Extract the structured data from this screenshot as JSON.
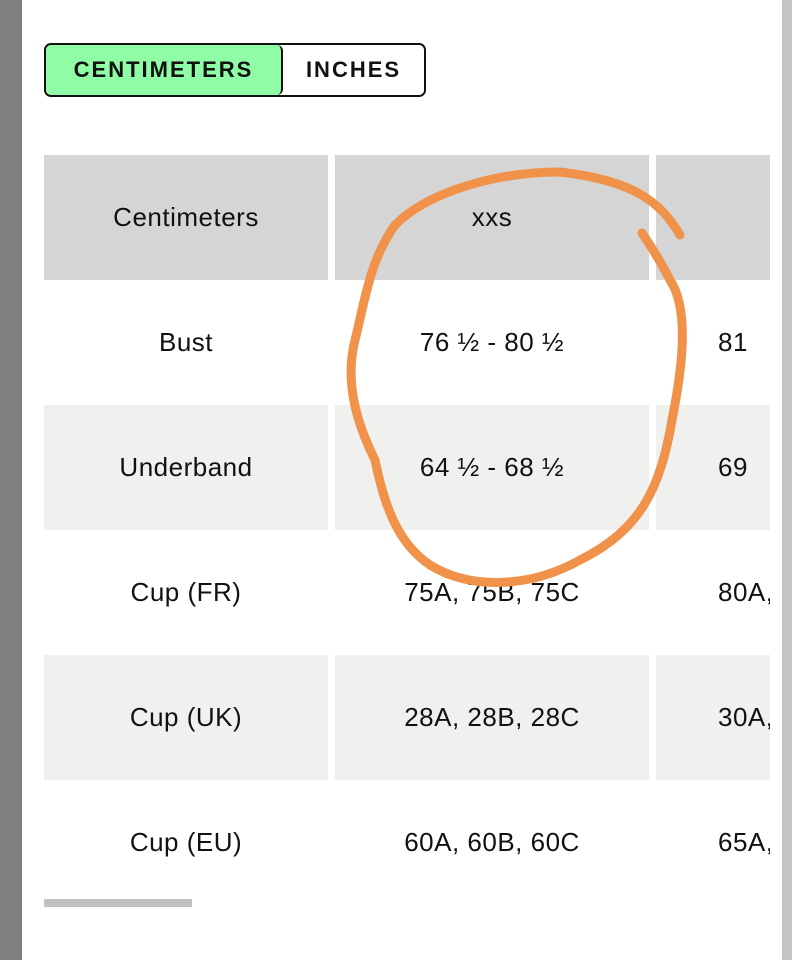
{
  "unit_toggle": {
    "options": [
      "CENTIMETERS",
      "INCHES"
    ],
    "selected": "CENTIMETERS",
    "active_color": "#8ffca6"
  },
  "table": {
    "header": [
      "Centimeters",
      "XXS",
      ""
    ],
    "rows": [
      [
        "Bust",
        "76 ½ - 80 ½",
        "81"
      ],
      [
        "Underband",
        "64 ½ - 68 ½",
        "69"
      ],
      [
        "Cup (FR)",
        "75A, 75B, 75C",
        "80A,"
      ],
      [
        "Cup (UK)",
        "28A, 28B, 28C",
        "30A,"
      ],
      [
        "Cup (EU)",
        "60A, 60B, 60C",
        "65A,"
      ]
    ]
  },
  "annotation": {
    "shape": "hand-drawn circle around XXS column",
    "color": "#f0924a"
  }
}
